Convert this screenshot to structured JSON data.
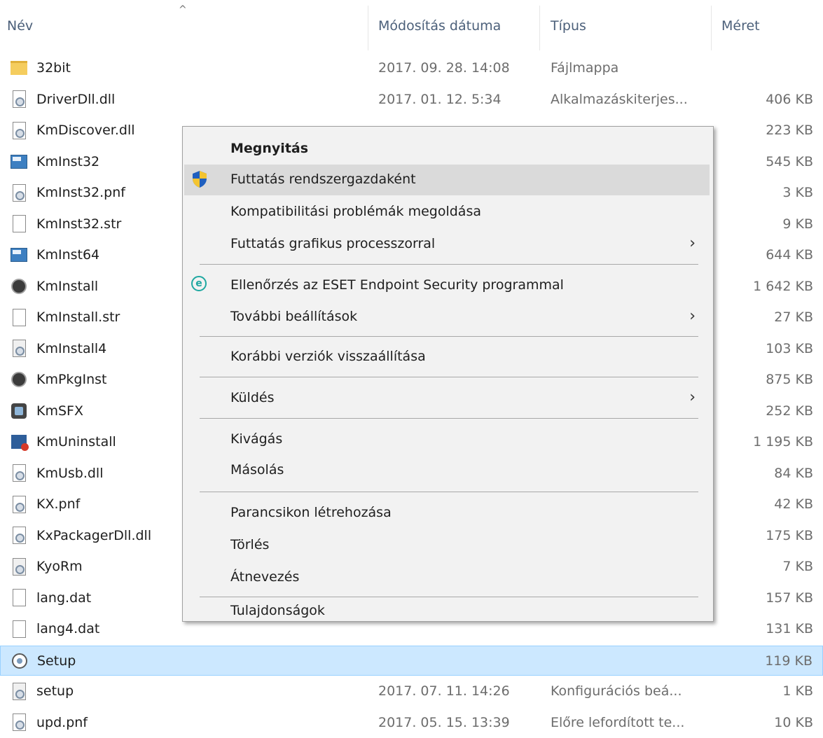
{
  "columns": {
    "name": "Név",
    "date": "Módosítás dátuma",
    "type": "Típus",
    "size": "Méret"
  },
  "files": [
    {
      "name": "32bit",
      "date": "2017. 09. 28. 14:08",
      "type": "Fájlmappa",
      "size": "",
      "icon": "folder-icon"
    },
    {
      "name": "DriverDll.dll",
      "date": "2017. 01. 12. 5:34",
      "type": "Alkalmazáskiterjes...",
      "size": "406 KB",
      "icon": "dll-file-icon"
    },
    {
      "name": "KmDiscover.dll",
      "date": "",
      "type": "",
      "size": "223 KB",
      "icon": "dll-file-icon"
    },
    {
      "name": "KmInst32",
      "date": "",
      "type": "",
      "size": "545 KB",
      "icon": "app-icon"
    },
    {
      "name": "KmInst32.pnf",
      "date": "",
      "type": "",
      "size": "3 KB",
      "icon": "pnf-file-icon"
    },
    {
      "name": "KmInst32.str",
      "date": "",
      "type": "",
      "size": "9 KB",
      "icon": "blank-file-icon"
    },
    {
      "name": "KmInst64",
      "date": "",
      "type": "",
      "size": "644 KB",
      "icon": "app-icon"
    },
    {
      "name": "KmInstall",
      "date": "",
      "type": "",
      "size": "1 642 KB",
      "icon": "installer-globe-icon"
    },
    {
      "name": "KmInstall.str",
      "date": "",
      "type": "",
      "size": "27 KB",
      "icon": "blank-file-icon"
    },
    {
      "name": "KmInstall4",
      "date": "",
      "type": "",
      "size": "103 KB",
      "icon": "config-file-icon"
    },
    {
      "name": "KmPkgInst",
      "date": "",
      "type": "",
      "size": "875 KB",
      "icon": "installer-globe-icon"
    },
    {
      "name": "KmSFX",
      "date": "",
      "type": "",
      "size": "252 KB",
      "icon": "sfx-icon"
    },
    {
      "name": "KmUninstall",
      "date": "",
      "type": "",
      "size": "1 195 KB",
      "icon": "uninstall-icon"
    },
    {
      "name": "KmUsb.dll",
      "date": "",
      "type": "",
      "size": "84 KB",
      "icon": "dll-file-icon"
    },
    {
      "name": "KX.pnf",
      "date": "",
      "type": "",
      "size": "42 KB",
      "icon": "pnf-file-icon"
    },
    {
      "name": "KxPackagerDll.dll",
      "date": "",
      "type": "",
      "size": "175 KB",
      "icon": "dll-file-icon"
    },
    {
      "name": "KyoRm",
      "date": "",
      "type": "",
      "size": "7 KB",
      "icon": "config-file-icon"
    },
    {
      "name": "lang.dat",
      "date": "",
      "type": "",
      "size": "157 KB",
      "icon": "blank-file-icon"
    },
    {
      "name": "lang4.dat",
      "date": "",
      "type": "",
      "size": "131 KB",
      "icon": "blank-file-icon"
    },
    {
      "name": "Setup",
      "date": "",
      "type": "",
      "size": "119 KB",
      "icon": "setup-icon",
      "selected": true
    },
    {
      "name": "setup",
      "date": "2017. 07. 11. 14:26",
      "type": "Konfigurációs beá...",
      "size": "1 KB",
      "icon": "config-file-icon"
    },
    {
      "name": "upd.pnf",
      "date": "2017. 05. 15. 13:39",
      "type": "Előre lefordított te...",
      "size": "10 KB",
      "icon": "pnf-file-icon"
    }
  ],
  "context_menu": {
    "items": {
      "open": "Megnyitás",
      "run_as_admin": "Futtatás rendszergazdaként",
      "compat": "Kompatibilitási problémák megoldása",
      "run_gpu": "Futtatás grafikus processzorral",
      "eset_scan": "Ellenőrzés az ESET Endpoint Security programmal",
      "more_settings": "További beállítások",
      "restore_versions": "Korábbi verziók visszaállítása",
      "send_to": "Küldés",
      "cut": "Kivágás",
      "copy": "Másolás",
      "create_shortcut": "Parancsikon létrehozása",
      "delete": "Törlés",
      "rename": "Átnevezés",
      "properties": "Tulajdonságok"
    },
    "submenu_glyph": "›",
    "hover_color": "#dadada"
  },
  "colors": {
    "selection_bg": "#cce8ff",
    "selection_border": "#99d1ff",
    "header_text": "#4c607a"
  }
}
